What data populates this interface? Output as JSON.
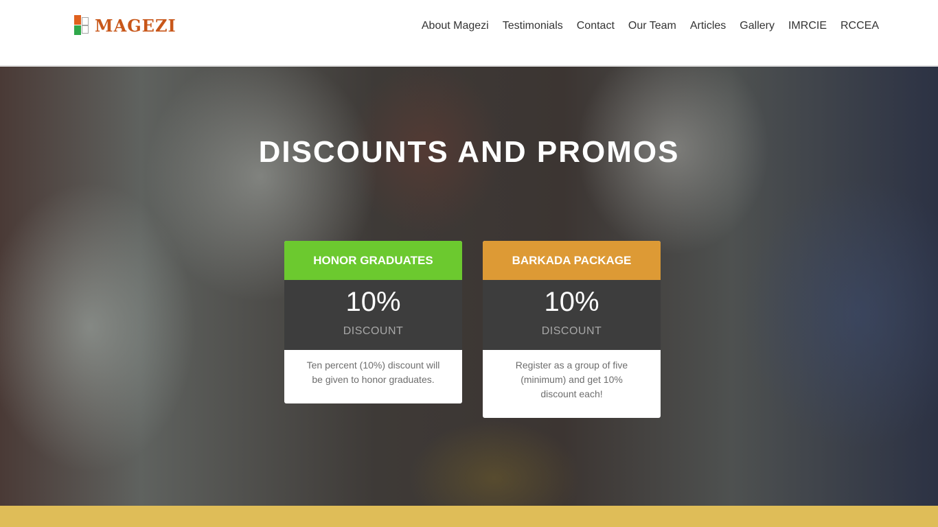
{
  "header": {
    "logo_text": "MAGEZI",
    "nav": [
      "About Magezi",
      "Testimonials",
      "Contact",
      "Our Team",
      "Articles",
      "Gallery",
      "IMRCIE",
      "RCCEA"
    ]
  },
  "hero": {
    "title": "DISCOUNTS AND PROMOS"
  },
  "promos": [
    {
      "title": "HONOR GRADUATES",
      "amount": "10%",
      "label": "DISCOUNT",
      "description": "Ten percent (10%) discount will be given to honor graduates.",
      "color": "#6cc92f"
    },
    {
      "title": "BARKADA PACKAGE",
      "amount": "10%",
      "label": "DISCOUNT",
      "description": "Register as a group of five (minimum) and get 10% discount each!",
      "color": "#dd9a35"
    }
  ],
  "colors": {
    "brand": "#c8571a",
    "band": "#dfbd58"
  }
}
